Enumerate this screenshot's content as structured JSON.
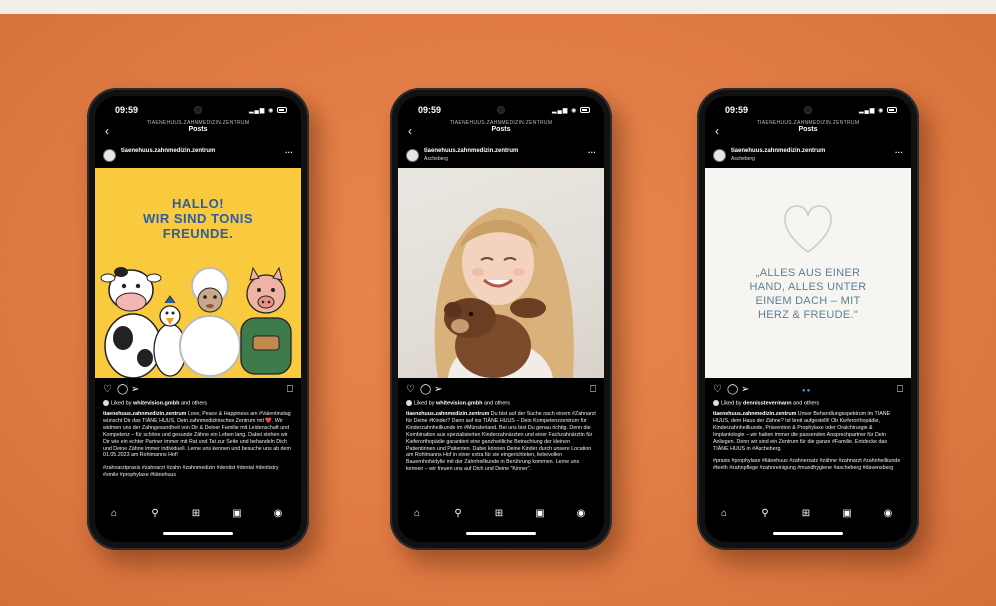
{
  "phones": [
    {
      "time": "09:59",
      "account_caps": "TIAENEHUUS.ZAHNMEDIZIN.ZENTRUM",
      "nav_title": "Posts",
      "username": "tiaenehuus.zahnmedizin.zentrum",
      "location": "",
      "post_text": [
        "HALLO!",
        "WIR SIND TONIS",
        "FREUNDE."
      ],
      "likes_prefix": "Liked by ",
      "liked_by": "whitevision.gmbh",
      "likes_suffix": " and others",
      "caption_user": "tiaenehuus.zahnmedizin.zentrum",
      "caption": "Love, Peace & Happiness am #Valentinstag wünscht Dir das TIÄNE HUUS, Dein zahnmedizinisches Zentrum mit ❤️. Wir widmen uns der Zahngesundheit von Dir & Deiner Familie mit Leidenschaft und Kompetenz – für schöne und gesunde Zähne ein Leben lang. Dabei stehen wir Dir wie ein echter Partner immer mit Rat und Tat zur Seite und behandeln Dich und Deine Zähne immer individuell. Lerne uns kennen und besuche uns ab dem 01.05.2023 am Rohlmanns Hof!",
      "hashtags": "#zahnarztpraxis #zahnarzt #zahn #zahnmedizin #dentist #dental #dentistry #smile #prophylaxe #tiänehuus"
    },
    {
      "time": "09:59",
      "account_caps": "TIAENEHUUS.ZAHNMEDIZIN.ZENTRUM",
      "nav_title": "Posts",
      "username": "tiaenehuus.zahnmedizin.zentrum",
      "location": "Ascheberg",
      "post_text": [],
      "likes_prefix": "Liked by ",
      "liked_by": "whitevision.gmbh",
      "likes_suffix": " and others",
      "caption_user": "tiaenehuus.zahnmedizin.zentrum",
      "caption": "Du bist auf der Suche nach einem #Zahnarzt für Deine #Kinder? Dann auf ins TIÄNE HUUS – Dein Kompetenzzentrum für Kinderzahnheilkunde im #Münsterland. Bei uns bist Du genau richtig. Denn die Kombination aus spezialisierten Kinderzahnärzten und einer Fachzahnärztin für Kieferorthopädie garantiert eine ganzheitliche Betrachtung der kleinen Patientinnen und Patienten. Dabei können Deine Kinder durch unsere Location am Rohlmanns Hof in einer extra für sie eingerichteten, liebevollen Bauernhofsidylle mit der Zahnheilkunde in Berührung kommen. Lerne uns kennen – wir freuen uns auf Dich und Deine \"Kinner\".",
      "hashtags": ""
    },
    {
      "time": "09:59",
      "account_caps": "TIAENEHUUS.ZAHNMEDIZIN.ZENTRUM",
      "nav_title": "Posts",
      "username": "tiaenehuus.zahnmedizin.zentrum",
      "location": "Ascheberg",
      "post_text": [
        "„ALLES AUS EINER",
        "HAND, ALLES UNTER",
        "EINEM DACH – MIT",
        "HERZ & FREUDE.\""
      ],
      "likes_prefix": "Liked by ",
      "liked_by": "dennisstevermann",
      "likes_suffix": " and others",
      "caption_user": "tiaenehuus.zahnmedizin.zentrum",
      "caption": "Unser Behandlungsspektrum im TIÄNE HUUS, dem Haus der Zähne? Ist breit aufgestellt! Ob Kieferorthopädie, Kinderzahnheilkunde, Prävention & Prophylaxe oder Oralchirurgie & Implantologie – wir haben immer die passenden Ansprechpartner für Dein Anliegen. Denn wir sind ein Zentrum für die ganze #Familie. Entdecke das TIÄNE HUUS in #Ascheberg.",
      "hashtags": "#praxis #prophylaxe #tiänehuus #zahnersatz #zähne #zahnarzt #zahnheilkunde #teeth #zahnpflege #zahnreinigung #mundhygiene #ascheberg #davensberg"
    }
  ],
  "icons": {
    "back": "chevron-left-icon",
    "more": "more-dots-icon",
    "actions": [
      "heart-icon",
      "comment-icon",
      "share-icon",
      "bookmark-icon"
    ],
    "tabs": [
      "home-icon",
      "search-icon",
      "new-post-icon",
      "reels-icon",
      "profile-icon"
    ]
  },
  "colors": {
    "background": "#e27c45",
    "post_yellow": "#f9c93e",
    "post_blue_text": "#2f5d9e",
    "quote_text": "#5b7f96"
  }
}
